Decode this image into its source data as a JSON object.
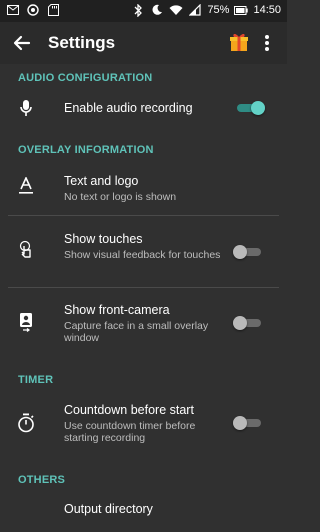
{
  "status_bar": {
    "battery": "75%",
    "time": "14:50"
  },
  "appbar": {
    "title": "Settings"
  },
  "sections": {
    "audio": "AUDIO CONFIGURATION",
    "overlay": "OVERLAY INFORMATION",
    "timer": "TIMER",
    "others": "OTHERS"
  },
  "items": {
    "audio_recording": {
      "title": "Enable audio recording",
      "enabled": true
    },
    "text_logo": {
      "title": "Text and logo",
      "summary": "No text or logo is shown"
    },
    "show_touches": {
      "title": "Show touches",
      "summary": "Show visual feedback for touches",
      "enabled": false
    },
    "front_camera": {
      "title": "Show front-camera",
      "summary": "Capture face in a small overlay window",
      "enabled": false
    },
    "countdown": {
      "title": "Countdown before start",
      "summary": "Use countdown timer before starting recording",
      "enabled": false
    },
    "output_directory": {
      "title": "Output directory"
    }
  },
  "colors": {
    "accent": "#5fc3b9",
    "background": "#303030",
    "toggle_on": "#63d2c7"
  },
  "icons": [
    "back-arrow-icon",
    "gift-icon",
    "more-vert-icon",
    "microphone-icon",
    "text-format-icon",
    "touch-icon",
    "front-camera-icon",
    "timer-icon"
  ]
}
